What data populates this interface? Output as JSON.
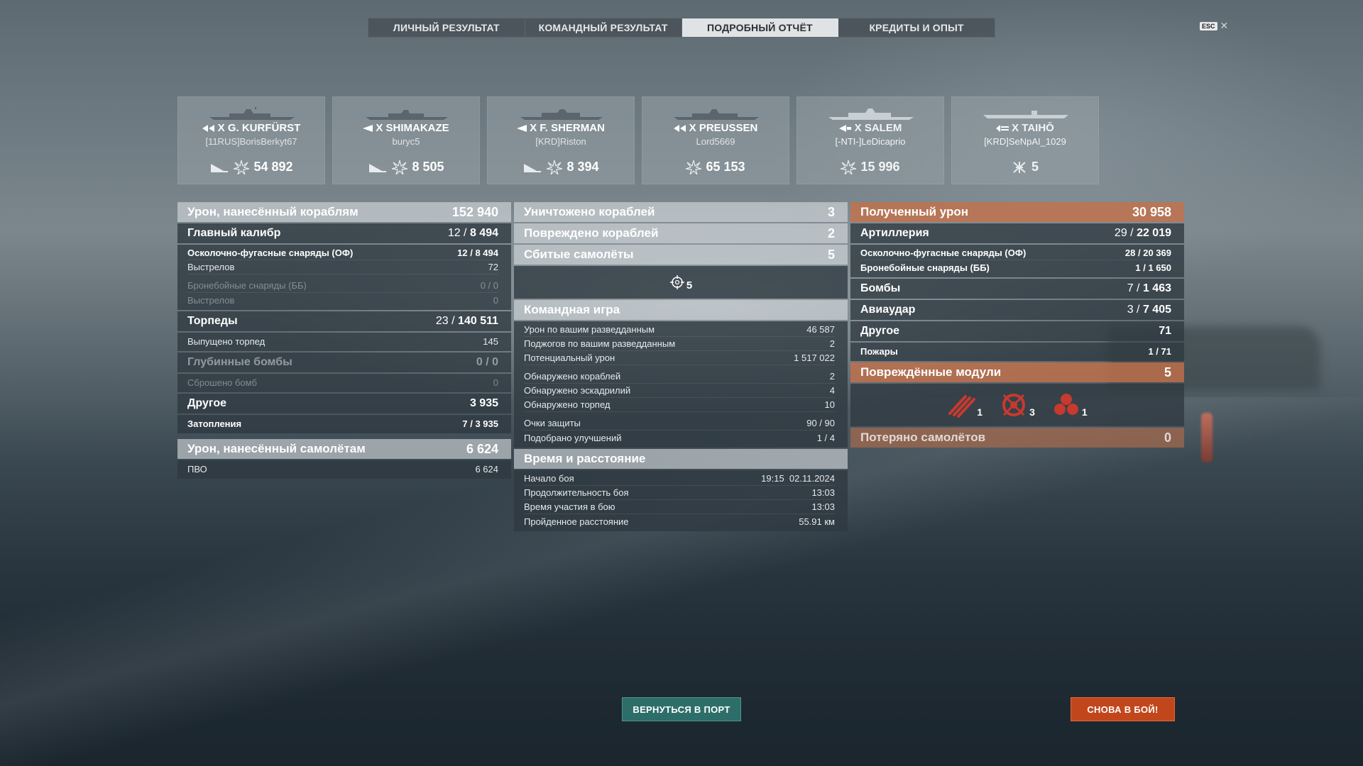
{
  "tabs": [
    {
      "label": "ЛИЧНЫЙ РЕЗУЛЬТАТ",
      "active": false
    },
    {
      "label": "КОМАНДНЫЙ РЕЗУЛЬТАТ",
      "active": false
    },
    {
      "label": "ПОДРОБНЫЙ ОТЧЁТ",
      "active": true
    },
    {
      "label": "КРЕДИТЫ И ОПЫТ",
      "active": false
    }
  ],
  "esc": {
    "key": "ESC",
    "close": "✕"
  },
  "ships": [
    {
      "name": "X G. KURFÜRST",
      "player": "[11RUS]BorisBerkyt67",
      "value": "54 892",
      "class_icon": "battleship-icon",
      "stat_icon": "damage-icon"
    },
    {
      "name": "X SHIMAKAZE",
      "player": "buryc5",
      "value": "8 505",
      "class_icon": "destroyer-icon",
      "stat_icon": "damage-icon"
    },
    {
      "name": "X F. SHERMAN",
      "player": "[KRD]Riston",
      "value": "8 394",
      "class_icon": "destroyer-icon",
      "stat_icon": "damage-icon"
    },
    {
      "name": "X PREUSSEN",
      "player": "Lord5669",
      "value": "65 153",
      "class_icon": "battleship-icon",
      "stat_icon": "damage-icon"
    },
    {
      "name": "X SALEM",
      "player": "[-NTI-]LeDicaprio",
      "value": "15 996",
      "class_icon": "cruiser-icon",
      "stat_icon": "damage-icon"
    },
    {
      "name": "X TAIHŌ",
      "player": "[KRD]SeNpAI_1029",
      "value": "5",
      "class_icon": "carrier-icon",
      "stat_icon": "planes-shot-icon"
    }
  ],
  "damage_ships": {
    "title": "Урон, нанесённый кораблям",
    "value": "152 940",
    "main_caliber": {
      "title": "Главный калибр",
      "hits": "12",
      "dmg": "8 494"
    },
    "he": {
      "label": "Осколочно-фугасные снаряды (ОФ)",
      "hits": "12",
      "dmg": "8 494"
    },
    "he_shots": {
      "label": "Выстрелов",
      "value": "72"
    },
    "ap": {
      "label": "Бронебойные снаряды (ББ)",
      "value": "0 / 0"
    },
    "ap_shots": {
      "label": "Выстрелов",
      "value": "0"
    },
    "torpedoes": {
      "title": "Торпеды",
      "hits": "23",
      "dmg": "140 511"
    },
    "torp_launched": {
      "label": "Выпущено торпед",
      "value": "145"
    },
    "depth": {
      "title": "Глубинные бомбы",
      "value": "0 / 0"
    },
    "depth_dropped": {
      "label": "Сброшено бомб",
      "value": "0"
    },
    "other": {
      "title": "Другое",
      "value": "3 935"
    },
    "flooding": {
      "label": "Затопления",
      "hits": "7",
      "dmg": "3 935"
    }
  },
  "damage_planes": {
    "title": "Урон, нанесённый самолётам",
    "value": "6 624",
    "aa": {
      "label": "ПВО",
      "value": "6 624"
    }
  },
  "destroyed": {
    "label": "Уничтожено кораблей",
    "value": "3"
  },
  "damaged": {
    "label": "Повреждено кораблей",
    "value": "2"
  },
  "planes_shot": {
    "label": "Сбитые самолёты",
    "value": "5",
    "detail": "5"
  },
  "team": {
    "title": "Командная игра",
    "rows1": [
      {
        "label": "Урон по вашим разведданным",
        "value": "46 587"
      },
      {
        "label": "Поджогов по вашим разведданным",
        "value": "2"
      },
      {
        "label": "Потенциальный урон",
        "value": "1 517 022"
      }
    ],
    "rows2": [
      {
        "label": "Обнаружено кораблей",
        "value": "2"
      },
      {
        "label": "Обнаружено эскадрилий",
        "value": "4"
      },
      {
        "label": "Обнаружено торпед",
        "value": "10"
      }
    ],
    "rows3": [
      {
        "label": "Очки защиты",
        "value": "90 / 90"
      },
      {
        "label": "Подобрано улучшений",
        "value": "1 / 4"
      }
    ]
  },
  "time": {
    "title": "Время и расстояние",
    "rows": [
      {
        "label": "Начало боя",
        "value": "19:15  02.11.2024"
      },
      {
        "label": "Продолжительность боя",
        "value": "13:03"
      },
      {
        "label": "Время участия в бою",
        "value": "13:03"
      },
      {
        "label": "Пройденное расстояние",
        "value": "55.91 км"
      }
    ]
  },
  "received": {
    "title": "Полученный урон",
    "value": "30 958",
    "artillery": {
      "title": "Артиллерия",
      "hits": "29",
      "dmg": "22 019"
    },
    "he": {
      "label": "Осколочно-фугасные снаряды (ОФ)",
      "hits": "28",
      "dmg": "20 369"
    },
    "ap": {
      "label": "Бронебойные снаряды (ББ)",
      "hits": "1",
      "dmg": "1 650"
    },
    "bombs": {
      "title": "Бомбы",
      "hits": "7",
      "dmg": "1 463"
    },
    "airstrike": {
      "title": "Авиаудар",
      "hits": "3",
      "dmg": "7 405"
    },
    "other": {
      "title": "Другое",
      "value": "71"
    },
    "fires": {
      "label": "Пожары",
      "hits": "1",
      "dmg": "71"
    }
  },
  "modules": {
    "title": "Повреждённые модули",
    "value": "5",
    "items": [
      {
        "icon": "torpedo-tubes-icon",
        "count": "1"
      },
      {
        "icon": "steering-icon",
        "count": "3"
      },
      {
        "icon": "aa-guns-icon",
        "count": "1"
      }
    ]
  },
  "lost_planes": {
    "title": "Потеряно самолётов",
    "value": "0"
  },
  "buttons": {
    "port": "ВЕРНУТЬСЯ В ПОРТ",
    "battle": "СНОВА В БОЙ!"
  },
  "colors": {
    "accent_orange": "#c2461c",
    "port_teal": "#2d6e6a",
    "received_header": "#c47048"
  }
}
